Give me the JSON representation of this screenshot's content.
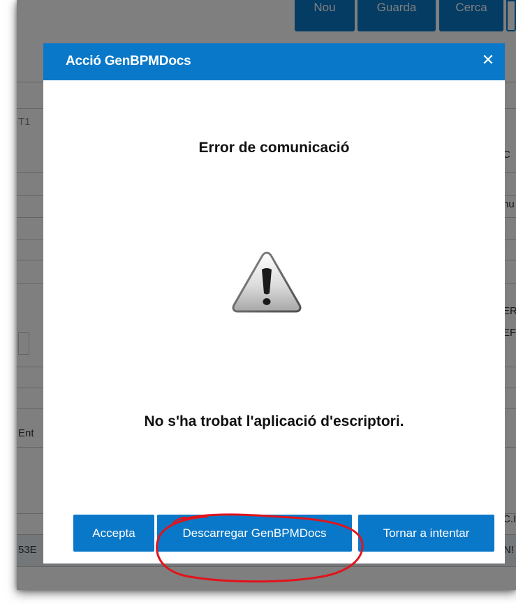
{
  "background_app": {
    "toolbar": {
      "new_label": "Nou",
      "save_label": "Guarda",
      "search_label": "Cerca"
    },
    "fragments": {
      "left_code": "T1",
      "left_label": "Ent",
      "bottom_left": "53E",
      "right_c": "C",
      "right_nu": "nu",
      "right_er1": "ER",
      "right_er2": "EF",
      "right_ci": "C.I",
      "right_ns": "N!"
    }
  },
  "dialog": {
    "title": "Acció GenBPMDocs",
    "close_icon": "close-icon",
    "error_title": "Error de comunicació",
    "warning_icon": "warning-icon",
    "message": "No s'ha trobat l'aplicació d'escriptori.",
    "buttons": {
      "accept": "Accepta",
      "download": "Descarregar GenBPMDocs",
      "retry": "Tornar a intentar"
    }
  },
  "annotation": {
    "circle_color": "#e0141c",
    "highlighted": "Descarregar GenBPMDocs"
  },
  "colors": {
    "accent": "#0a78c8",
    "overlay": "rgba(0,0,0,0.5)"
  }
}
